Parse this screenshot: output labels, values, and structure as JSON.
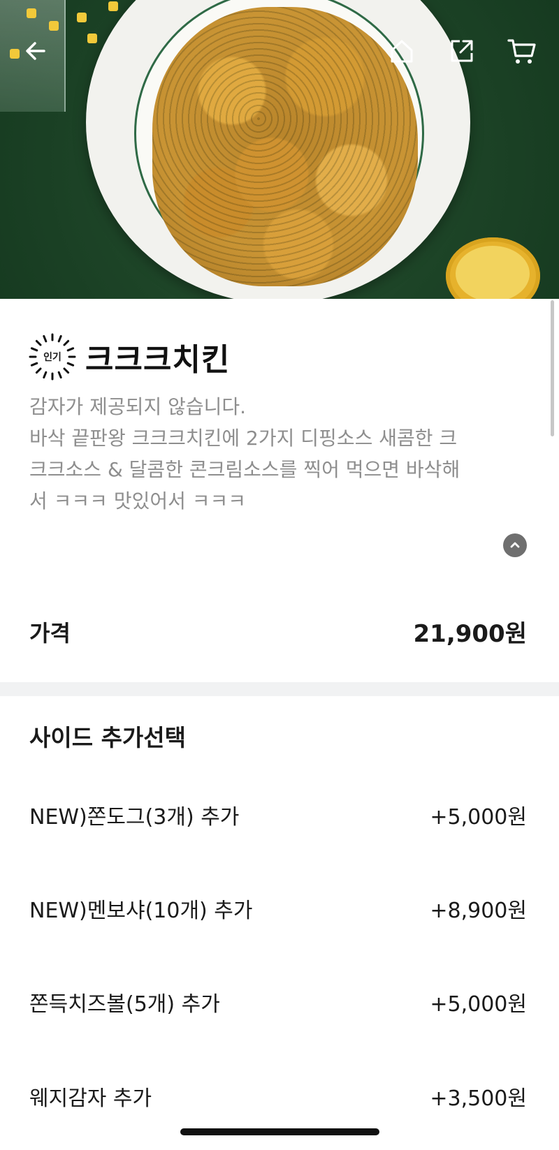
{
  "header": {
    "back_icon": "arrow-left-icon",
    "home_icon": "home-icon",
    "share_icon": "share-icon",
    "cart_icon": "cart-icon"
  },
  "menu": {
    "badge": "인기",
    "title": "크크크치킨",
    "description": [
      "감자가 제공되지 않습니다.",
      "바삭 끝판왕 크크크치킨에 2가지 디핑소스 새콤한 크",
      "크크소스 & 달콤한 콘크림소스를 찍어 먹으면 바삭해",
      "서 ㅋㅋㅋ 맛있어서 ㅋㅋㅋ"
    ],
    "collapse_icon": "chevron-up-icon"
  },
  "price": {
    "label": "가격",
    "value": "21,900원"
  },
  "side_options": {
    "title": "사이드 추가선택",
    "items": [
      {
        "name": "NEW)쫀도그(3개) 추가",
        "price": "+5,000원"
      },
      {
        "name": "NEW)멘보샤(10개) 추가",
        "price": "+8,900원"
      },
      {
        "name": "쫀득치즈볼(5개) 추가",
        "price": "+5,000원"
      },
      {
        "name": "웨지감자 추가",
        "price": "+3,500원"
      }
    ]
  },
  "colors": {
    "hero_green": "#1f4a2a",
    "text_primary": "#1a1a1a",
    "text_secondary": "#8e8e8e",
    "divider": "#f1f2f3"
  }
}
